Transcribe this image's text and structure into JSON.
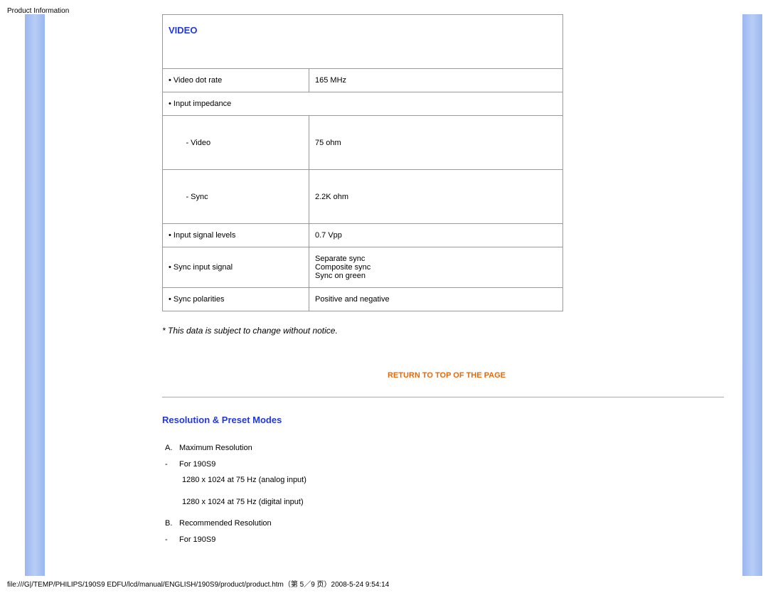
{
  "header": "Product Information",
  "video": {
    "title": "VIDEO",
    "rows": [
      {
        "label": "• Video dot rate",
        "value": "165 MHz"
      },
      {
        "label": "• Input impedance",
        "value": ""
      },
      {
        "label": "        - Video",
        "value": "75 ohm"
      },
      {
        "label": "        - Sync",
        "value": "2.2K ohm"
      },
      {
        "label": "• Input signal levels",
        "value": "0.7 Vpp"
      },
      {
        "label": "• Sync input signal",
        "value": "Separate sync\nComposite sync\nSync on green"
      },
      {
        "label": "• Sync polarities",
        "value": "Positive and negative"
      }
    ]
  },
  "disclaimer": "* This data is subject to change without notice.",
  "return_link": "RETURN TO TOP OF THE PAGE",
  "resolution": {
    "title": "Resolution & Preset Modes",
    "items": {
      "a_label": "A.",
      "a_text": "Maximum Resolution",
      "a_sub_marker": "-",
      "a_sub_text": "For 190S9",
      "a_data1": "1280 x 1024 at 75 Hz (analog input)",
      "a_data2": "1280 x 1024 at 75 Hz (digital input)",
      "b_label": "B.",
      "b_text": "Recommended Resolution",
      "b_sub_marker": "-",
      "b_sub_text": "For 190S9"
    }
  },
  "footer": "file:///G|/TEMP/PHILIPS/190S9 EDFU/lcd/manual/ENGLISH/190S9/product/product.htm（第 5／9 页）2008-5-24 9:54:14"
}
